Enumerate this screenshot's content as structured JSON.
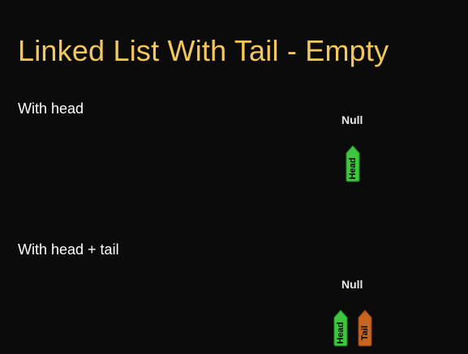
{
  "title": "Linked List With Tail - Empty",
  "sections": [
    {
      "label": "With head",
      "null_label": "Null",
      "pointers": [
        {
          "label": "Head",
          "color": "#3ec63e",
          "stroke": "#1f8a1f"
        }
      ]
    },
    {
      "label": "With head + tail",
      "null_label": "Null",
      "pointers": [
        {
          "label": "Head",
          "color": "#3ec63e",
          "stroke": "#1f8a1f"
        },
        {
          "label": "Tail",
          "color": "#c9651f",
          "stroke": "#8a4210"
        }
      ]
    }
  ]
}
